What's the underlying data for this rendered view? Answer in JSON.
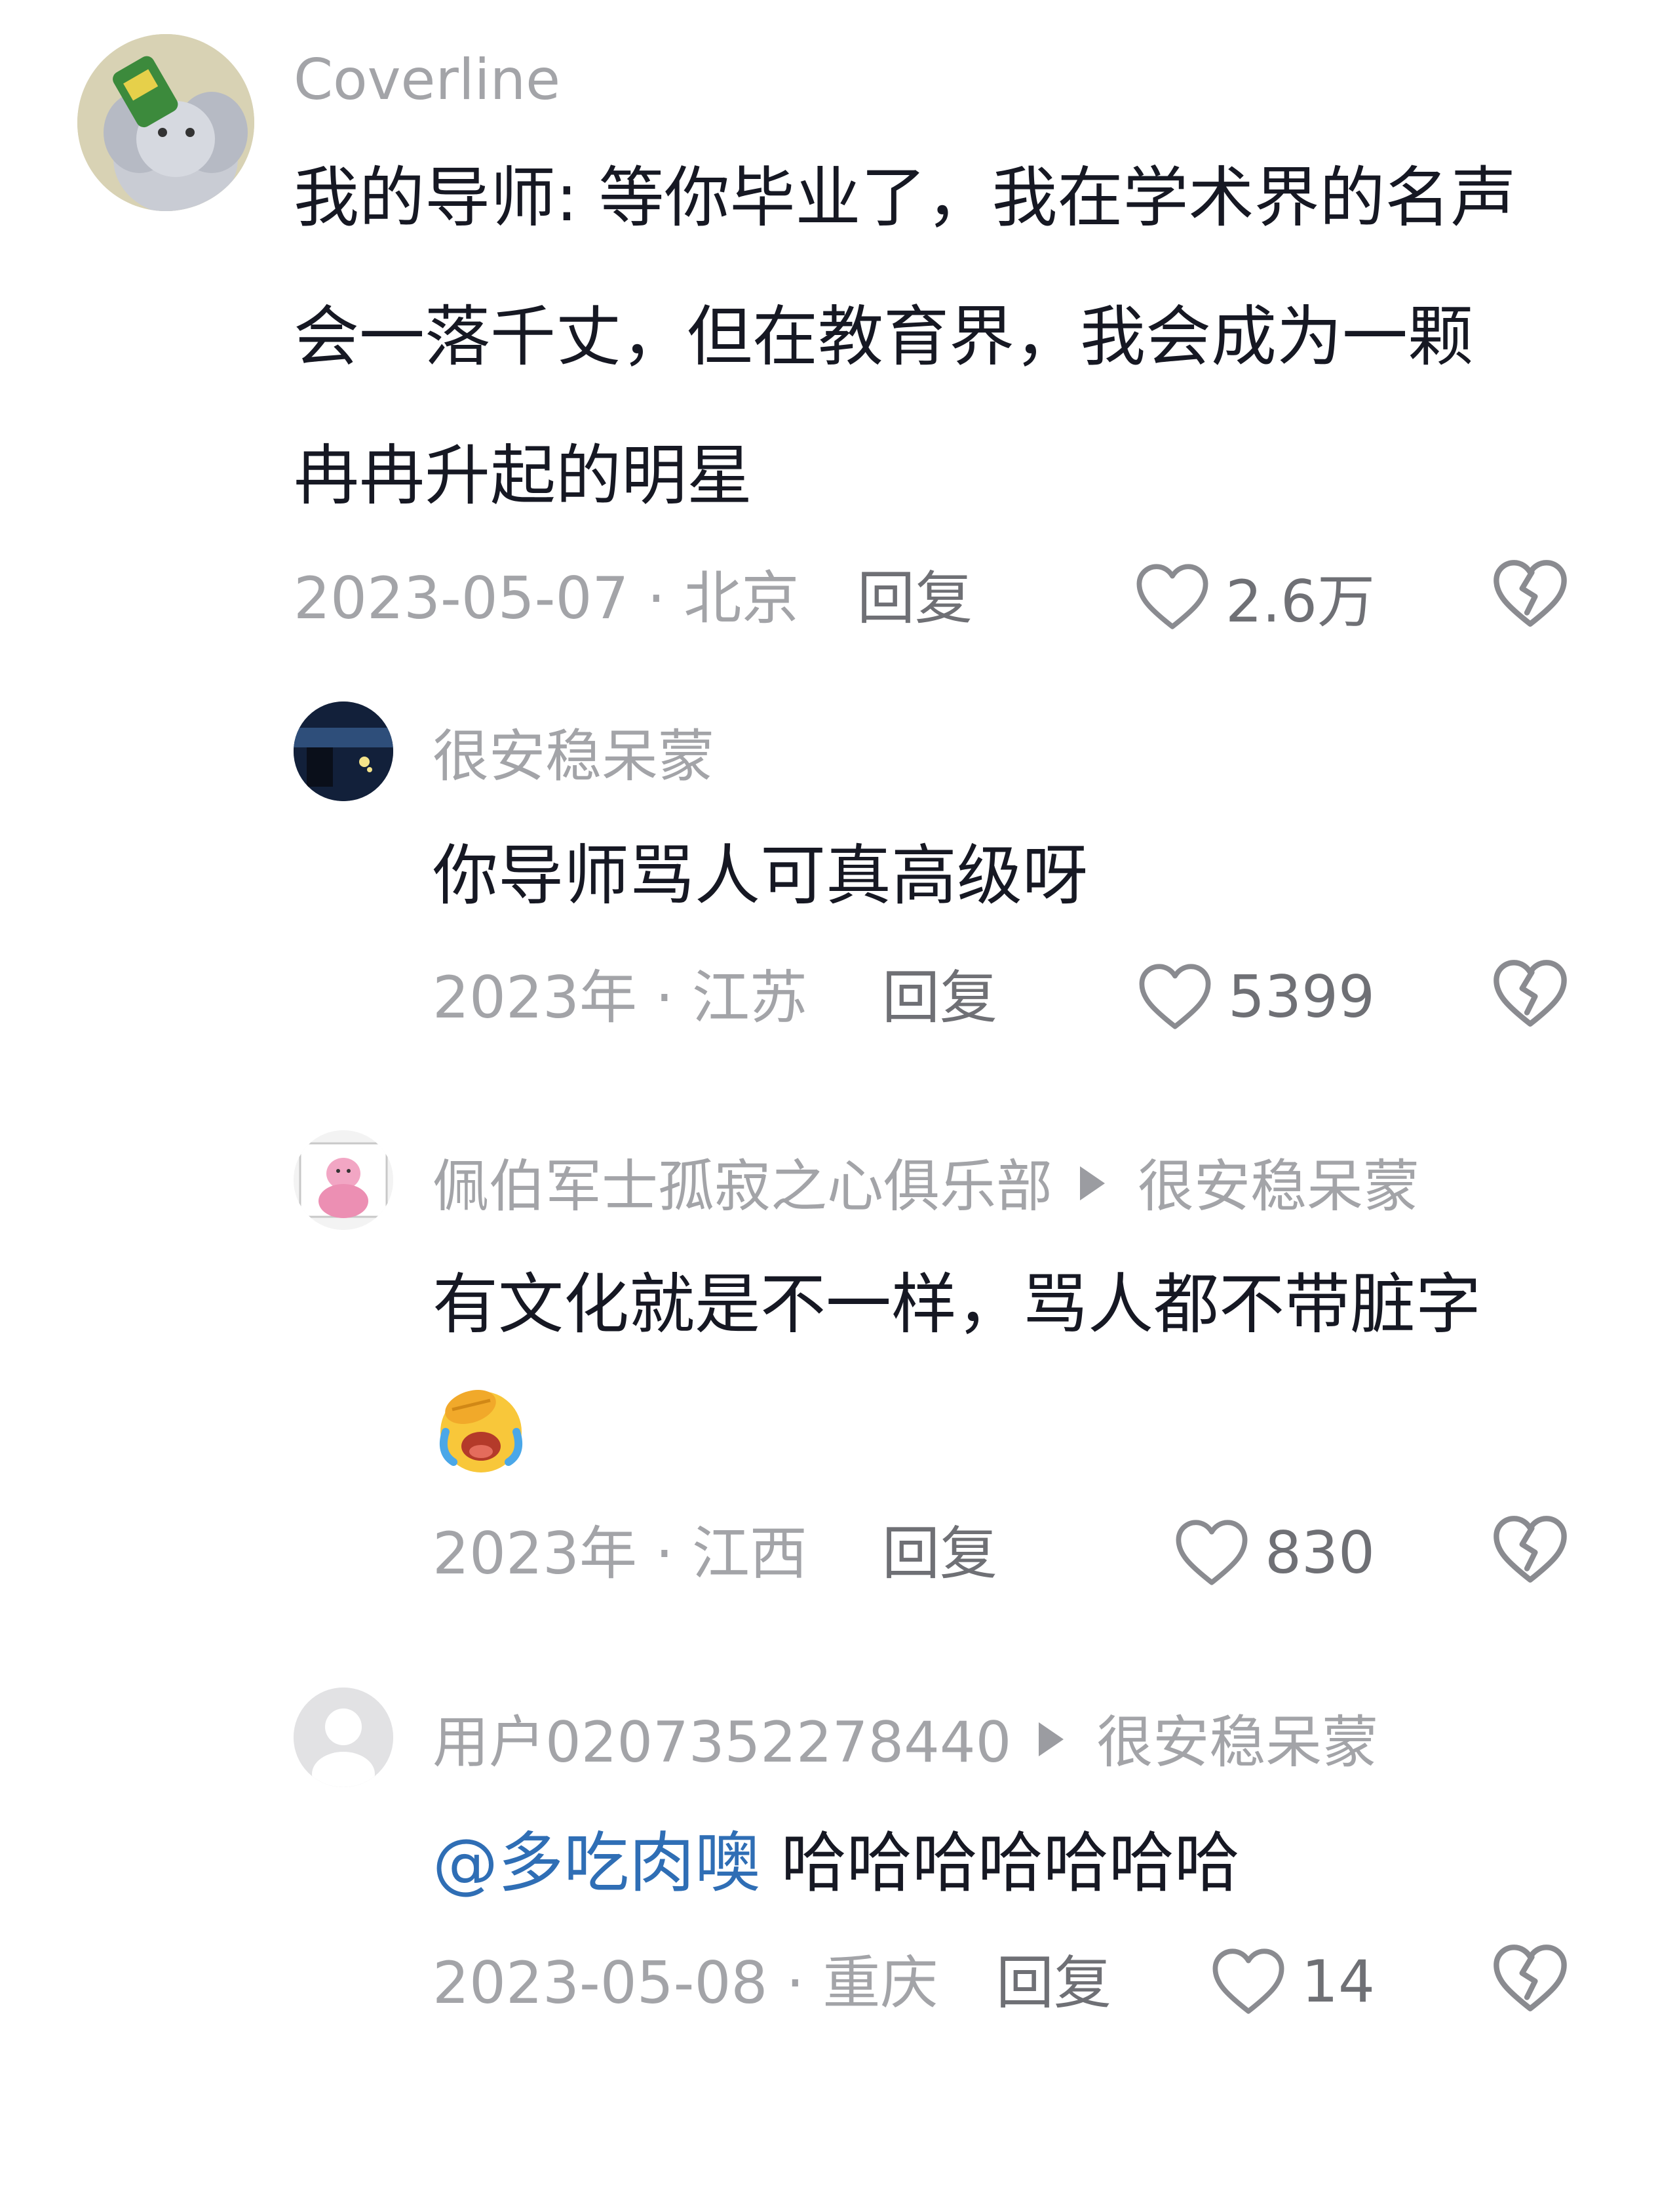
{
  "comments": [
    {
      "username": "Coverline",
      "content_lines": [
        "我的导师: 等你毕业了，我在学术界的名声",
        "会一落千丈，但在教育界，我会成为一颗",
        "冉冉升起的明星"
      ],
      "date_location": "2023-05-07 · 北京",
      "reply_label": "回复",
      "likes": "2.6万",
      "avatar_icon": "cartoon-elephant-avatar-icon"
    },
    {
      "username": "很安稳呆蒙",
      "content_lines": [
        "你导师骂人可真高级呀"
      ],
      "date_location": "2023年 · 江苏",
      "reply_label": "回复",
      "likes": "5399",
      "avatar_icon": "night-scene-avatar-icon"
    },
    {
      "username": "佩伯军士孤寂之心俱乐部",
      "reply_to": "很安稳呆蒙",
      "content_lines": [
        "有文化就是不一样，骂人都不带脏字"
      ],
      "emoji": "facepalm-laughing-emoji",
      "date_location": "2023年 · 江西",
      "reply_label": "回复",
      "likes": "830",
      "avatar_icon": "cartoon-character-avatar-icon"
    },
    {
      "username": "用户0207352278440",
      "reply_to": "很安稳呆蒙",
      "mention": "@多吃肉噢",
      "content_after_mention": " 哈哈哈哈哈哈哈",
      "date_location": "2023-05-08 · 重庆",
      "reply_label": "回复",
      "likes": "14",
      "avatar_icon": "default-user-avatar-icon"
    }
  ],
  "colors": {
    "text_primary": "#161823",
    "text_secondary": "#a3a4a8",
    "mention": "#2f6eb5",
    "icon": "#8a8b90"
  }
}
